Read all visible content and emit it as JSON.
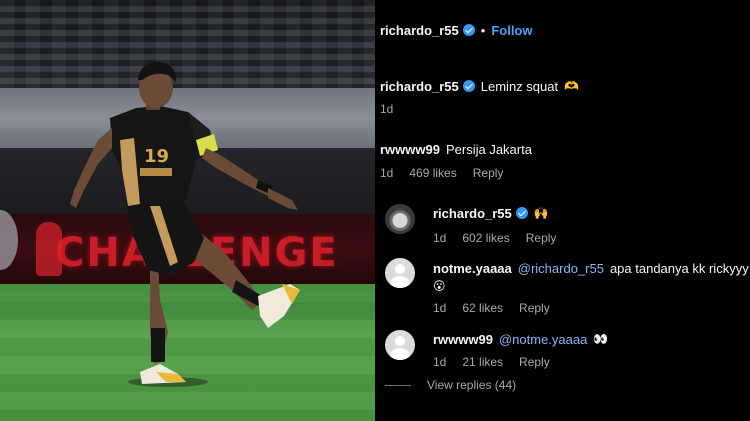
{
  "photo": {
    "jersey_number": "19",
    "ad_text": "CHALLENGE"
  },
  "post": {
    "author": "richardo_r55",
    "separator": "•",
    "follow_label": "Follow",
    "caption": {
      "username": "richardo_r55",
      "text": "Leminz squat",
      "emoji": "🫶",
      "time": "1d"
    }
  },
  "comments": [
    {
      "username": "rwwww99",
      "text": "Persija Jakarta",
      "time": "1d",
      "likes": "469 likes",
      "reply_label": "Reply"
    },
    {
      "username": "richardo_r55",
      "text": "",
      "emoji": "🙌",
      "time": "1d",
      "likes": "602 likes",
      "reply_label": "Reply"
    },
    {
      "username": "notme.yaaaa",
      "mention": "@richardo_r55",
      "text": "apa tandanya kk rickyyy",
      "emoji": "😮",
      "time": "1d",
      "likes": "62 likes",
      "reply_label": "Reply"
    },
    {
      "username": "rwwww99",
      "mention": "@notme.yaaaa",
      "emoji": "👀",
      "time": "1d",
      "likes": "21 likes",
      "reply_label": "Reply"
    }
  ],
  "view_replies": "View replies (44)",
  "colors": {
    "background": "#000000",
    "link": "#4aa3ff",
    "mention": "#8ab4f8",
    "muted": "#a8a8a8",
    "verified": "#3897f0"
  }
}
